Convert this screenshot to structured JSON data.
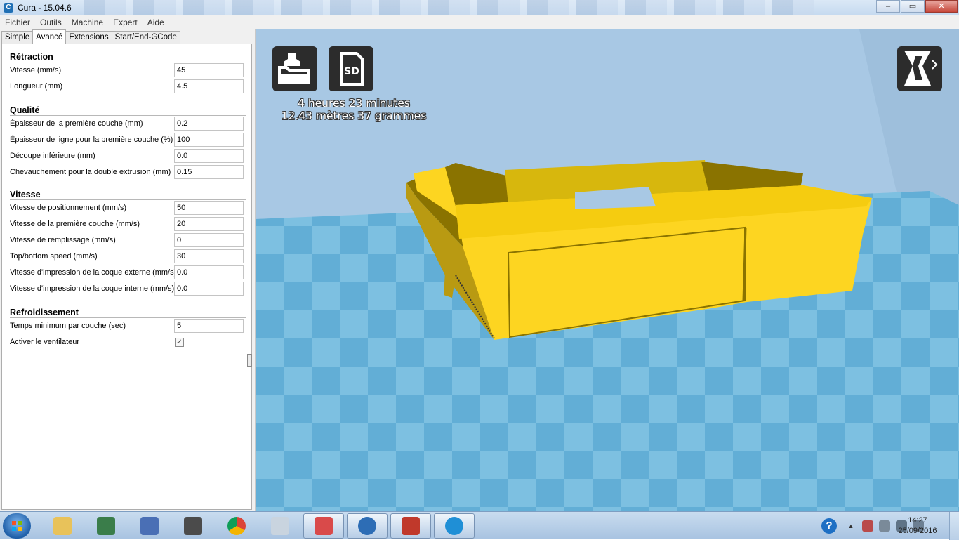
{
  "window": {
    "title": "Cura - 15.04.6",
    "app_icon": "C",
    "minimize": "–",
    "maximize": "▭",
    "close": "✕"
  },
  "menu": [
    "Fichier",
    "Outils",
    "Machine",
    "Expert",
    "Aide"
  ],
  "tabs": [
    "Simple",
    "Avancé",
    "Extensions",
    "Start/End-GCode"
  ],
  "active_tab": "Avancé",
  "settings": {
    "retraction": {
      "title": "Rétraction",
      "rows": [
        {
          "label": "Vitesse (mm/s)",
          "value": "45"
        },
        {
          "label": "Longueur (mm)",
          "value": "4.5"
        }
      ]
    },
    "quality": {
      "title": "Qualité",
      "rows": [
        {
          "label": "Épaisseur de la première couche (mm)",
          "value": "0.2"
        },
        {
          "label": "Épaisseur de ligne pour la première couche (%)",
          "value": "100"
        },
        {
          "label": "Découpe inférieure (mm)",
          "value": "0.0"
        },
        {
          "label": "Chevauchement pour la double extrusion (mm)",
          "value": "0.15"
        }
      ]
    },
    "speed": {
      "title": "Vitesse",
      "rows": [
        {
          "label": "Vitesse de positionnement (mm/s)",
          "value": "50"
        },
        {
          "label": "Vitesse de la première couche (mm/s)",
          "value": "20"
        },
        {
          "label": "Vitesse de remplissage (mm/s)",
          "value": "0"
        },
        {
          "label": "Top/bottom speed (mm/s)",
          "value": "30"
        },
        {
          "label": "Vitesse d'impression de la coque externe (mm/s)",
          "value": "0.0"
        },
        {
          "label": "Vitesse d'impression de la coque interne (mm/s)",
          "value": "0.0"
        }
      ]
    },
    "cooling": {
      "title": "Refroidissement",
      "rows": [
        {
          "label": "Temps minimum par couche (sec)",
          "value": "5"
        }
      ],
      "fan_label": "Activer le ventilateur",
      "fan_checked": "✓"
    }
  },
  "viewport": {
    "print_time": "4 heures 23 minutes",
    "print_material": "12.43 mètres 37 grammes",
    "sd_label": "SD",
    "model_color": "#fdd521",
    "floor_light": "#85c5e3",
    "floor_dark": "#5ba9d3"
  },
  "taskbar": {
    "time": "14:27",
    "date": "25/09/2016",
    "help": "?"
  }
}
